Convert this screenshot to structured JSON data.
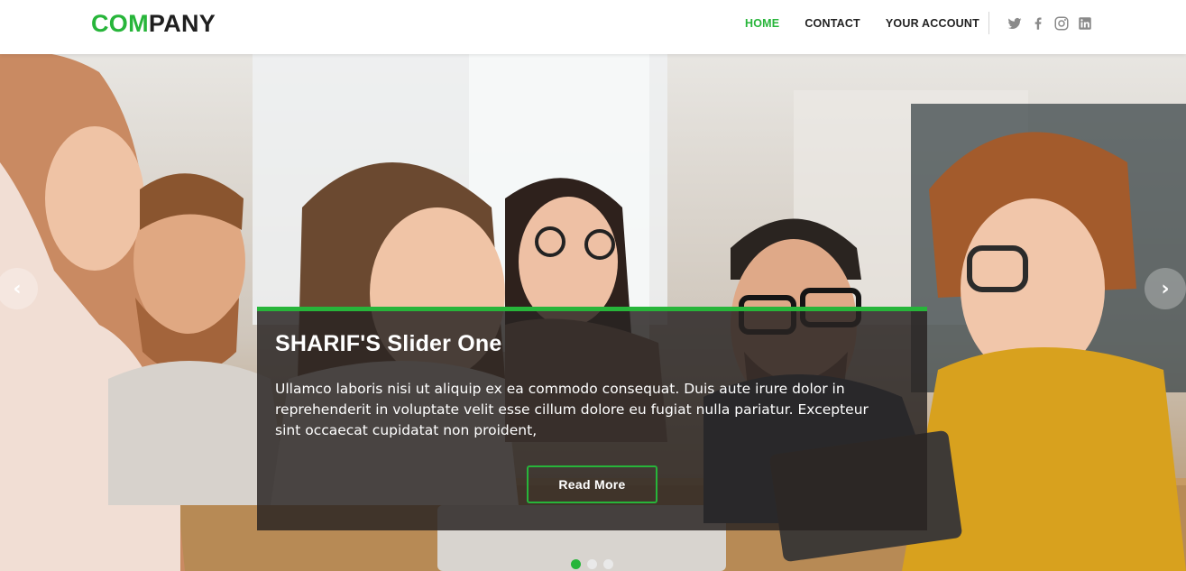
{
  "brand": {
    "accent": "COM",
    "rest": "PANY"
  },
  "nav": {
    "items": [
      {
        "label": "HOME",
        "active": true
      },
      {
        "label": "CONTACT",
        "active": false
      },
      {
        "label": "YOUR ACCOUNT",
        "active": false
      }
    ]
  },
  "social": [
    "twitter-icon",
    "facebook-icon",
    "instagram-icon",
    "linkedin-icon"
  ],
  "slider": {
    "title": "SHARIF'S Slider One",
    "text": "Ullamco laboris nisi ut aliquip ex ea commodo consequat. Duis aute irure dolor in reprehenderit in voluptate velit esse cillum dolore eu fugiat nulla pariatur. Excepteur sint occaecat cupidatat non proident,",
    "button_label": "Read More",
    "prev_glyph": "‹",
    "next_glyph": "›",
    "slide_count": 3,
    "active_slide": 1
  },
  "colors": {
    "accent": "#27b53a",
    "text_dark": "#222222",
    "caption_bg": "#282422"
  }
}
